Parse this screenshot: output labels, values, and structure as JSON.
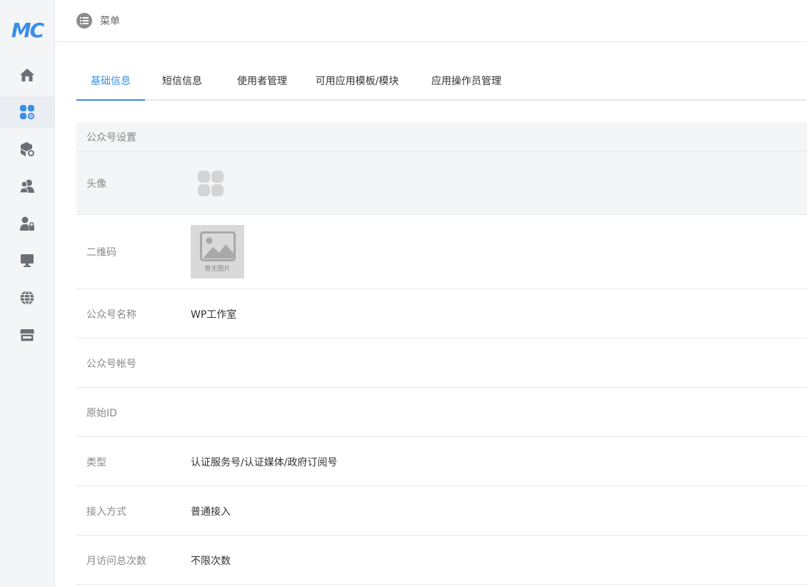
{
  "app": {
    "logo_text": "MC",
    "accent_color": "#3a8ee6"
  },
  "sidebar": {
    "items": [
      {
        "icon": "home-icon",
        "active": false
      },
      {
        "icon": "apps-settings-icon",
        "active": true
      },
      {
        "icon": "box-settings-icon",
        "active": false
      },
      {
        "icon": "users-icon",
        "active": false
      },
      {
        "icon": "user-lock-icon",
        "active": false
      },
      {
        "icon": "monitor-icon",
        "active": false
      },
      {
        "icon": "globe-icon",
        "active": false
      },
      {
        "icon": "store-icon",
        "active": false
      }
    ]
  },
  "header": {
    "menu_label": "菜单",
    "menu_icon": "list-icon"
  },
  "tabs": [
    {
      "label": "基础信息",
      "active": true
    },
    {
      "label": "短信信息",
      "active": false
    },
    {
      "label": "使用者管理",
      "active": false
    },
    {
      "label": "可用应用模板/模块",
      "active": false
    },
    {
      "label": "应用操作员管理",
      "active": false
    }
  ],
  "section": {
    "title": "公众号设置",
    "rows": {
      "avatar": {
        "label": "头像"
      },
      "qrcode": {
        "label": "二维码",
        "placeholder_text": "暂无图片"
      },
      "name": {
        "label": "公众号名称",
        "value": "WP工作室"
      },
      "account": {
        "label": "公众号帐号",
        "value": ""
      },
      "original_id": {
        "label": "原始ID",
        "value": ""
      },
      "type": {
        "label": "类型",
        "value": "认证服务号/认证媒体/政府订阅号"
      },
      "access": {
        "label": "接入方式",
        "value": "普通接入"
      },
      "monthly_visits": {
        "label": "月访问总次数",
        "value": "不限次数"
      }
    }
  }
}
